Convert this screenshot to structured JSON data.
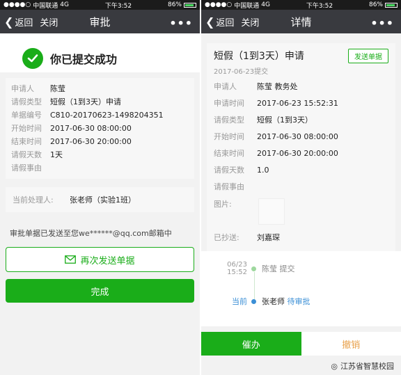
{
  "left": {
    "status": {
      "carrier": "中国联通",
      "network": "4G",
      "time": "下午3:52",
      "battery": "86%"
    },
    "nav": {
      "back": "返回",
      "close": "关闭",
      "title": "审批",
      "more": "•••"
    },
    "success_text": "你已提交成功",
    "info": [
      {
        "k": "申请人",
        "v": "陈莹"
      },
      {
        "k": "请假类型",
        "v": "短假（1到3天）申请"
      },
      {
        "k": "单据编号",
        "v": "C810-20170623-1498204351"
      },
      {
        "k": "开始时间",
        "v": "2017-06-30 08:00:00"
      },
      {
        "k": "结束时间",
        "v": "2017-06-30 20:00:00"
      },
      {
        "k": "请假天数",
        "v": "1天"
      },
      {
        "k": "请假事由",
        "v": ""
      }
    ],
    "handler_label": "当前处理人:",
    "handler_value": "张老师（实验1班）",
    "sent_note": "审批单据已发送至您we******@qq.com邮箱中",
    "resend_button": "再次发送单据",
    "done_button": "完成"
  },
  "right": {
    "status": {
      "carrier": "中国联通",
      "network": "4G",
      "time": "下午3:52",
      "battery": "86%"
    },
    "nav": {
      "back": "返回",
      "close": "关闭",
      "title": "详情",
      "more": "•••"
    },
    "detail_title": "短假（1到3天）申请",
    "resend_button": "发送单据",
    "submitted_date": "2017-06-23提交",
    "rows": [
      {
        "k": "申请人",
        "v": "陈莹 教务处"
      },
      {
        "k": "申请时间",
        "v": "2017-06-23 15:52:31"
      },
      {
        "k": "请假类型",
        "v": "短假（1到3天）"
      },
      {
        "k": "开始时间",
        "v": "2017-06-30 08:00:00"
      },
      {
        "k": "结束时间",
        "v": "2017-06-30 20:00:00"
      },
      {
        "k": "请假天数",
        "v": "1.0"
      },
      {
        "k": "请假事由",
        "v": ""
      }
    ],
    "image_label": "图片:",
    "cc_label": "已抄送:",
    "cc_value": "刘嘉琛",
    "timeline": [
      {
        "time_line1": "06/23",
        "time_line2": "15:52",
        "text": "陈莹 提交"
      },
      {
        "now_label": "当前",
        "person": "张老师",
        "status": "待审批"
      }
    ],
    "approve_button": "催办",
    "revoke_button": "撤销",
    "watermark": "江苏省智慧校园"
  },
  "colors": {
    "accent": "#1aad19",
    "link": "#3b8fd6",
    "revoke": "#e8a04a",
    "navbar": "#393a3f"
  },
  "icons": [
    "back-chevron-icon",
    "check-icon",
    "mail-icon",
    "more-icon",
    "battery-icon",
    "signal-icon",
    "wechat-icon"
  ]
}
